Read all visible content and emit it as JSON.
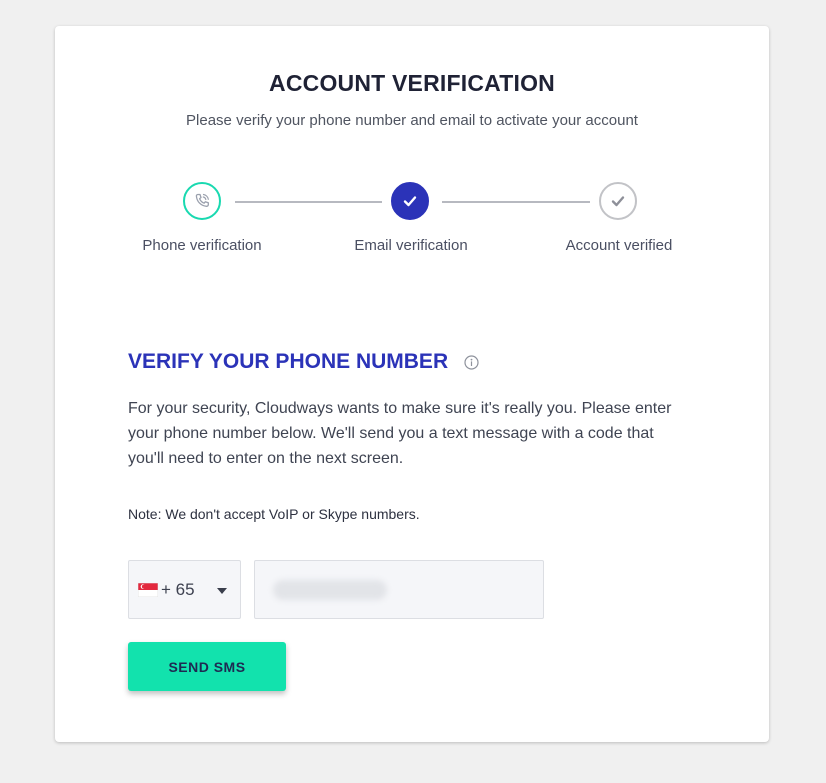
{
  "header": {
    "title": "ACCOUNT VERIFICATION",
    "subtitle": "Please verify your phone number and email to activate your account"
  },
  "steps": [
    {
      "label": "Phone verification",
      "icon": "phone-icon",
      "state": "active"
    },
    {
      "label": "Email verification",
      "icon": "check-icon",
      "state": "completed"
    },
    {
      "label": "Account verified",
      "icon": "check-icon",
      "state": "pending"
    }
  ],
  "section": {
    "title": "VERIFY YOUR PHONE NUMBER",
    "info_icon": "info-icon",
    "description": "For your security, Cloudways wants to make sure it's really you. Please enter your phone number below. We'll send you a text message with a code that you'll need to enter on the next screen.",
    "note": "Note: We don't accept VoIP or Skype numbers."
  },
  "form": {
    "country": {
      "flag": "singapore-flag-icon",
      "dial_code": "+ 65"
    },
    "phone_value": "",
    "send_label": "SEND SMS"
  },
  "colors": {
    "accent_teal": "#12e2ad",
    "brand_blue": "#2b33b8",
    "muted_gray": "#c2c3c7"
  }
}
